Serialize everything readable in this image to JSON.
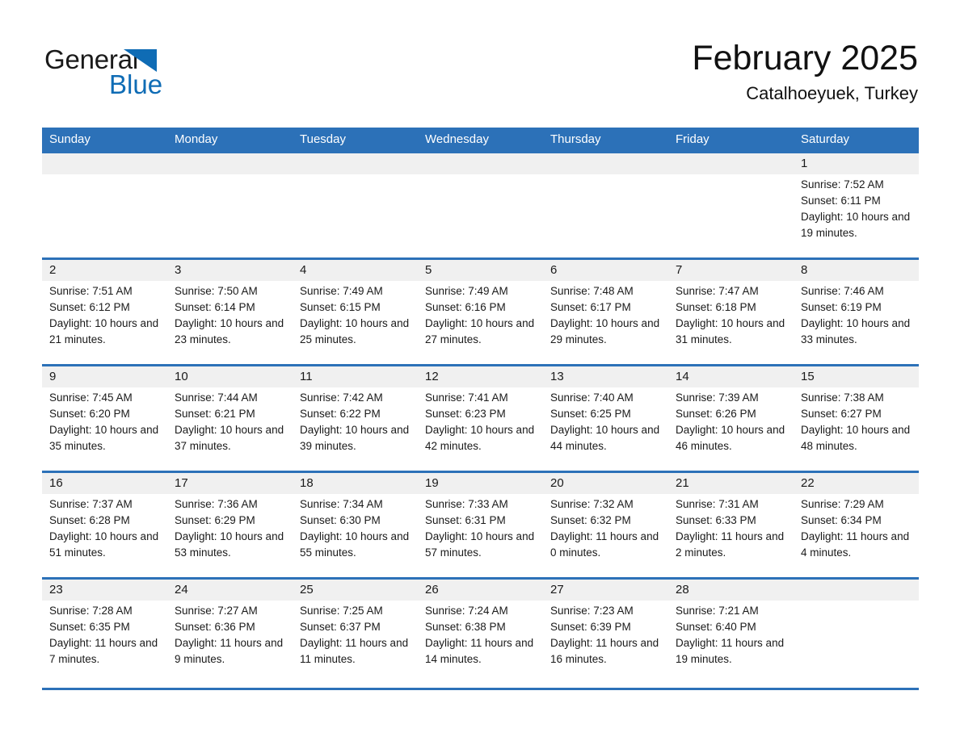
{
  "brand": {
    "name_part1": "General",
    "name_part2": "Blue",
    "logo_color": "#0f6cb5"
  },
  "header": {
    "title": "February 2025",
    "subtitle": "Catalhoeyuek, Turkey"
  },
  "theme": {
    "header_blue": "#2c71b8",
    "band_gray": "#f0f0f0",
    "text": "#1a1a1a"
  },
  "weekdays": [
    "Sunday",
    "Monday",
    "Tuesday",
    "Wednesday",
    "Thursday",
    "Friday",
    "Saturday"
  ],
  "weeks": [
    [
      {
        "day": "",
        "sunrise": "",
        "sunset": "",
        "daylight": ""
      },
      {
        "day": "",
        "sunrise": "",
        "sunset": "",
        "daylight": ""
      },
      {
        "day": "",
        "sunrise": "",
        "sunset": "",
        "daylight": ""
      },
      {
        "day": "",
        "sunrise": "",
        "sunset": "",
        "daylight": ""
      },
      {
        "day": "",
        "sunrise": "",
        "sunset": "",
        "daylight": ""
      },
      {
        "day": "",
        "sunrise": "",
        "sunset": "",
        "daylight": ""
      },
      {
        "day": "1",
        "sunrise": "Sunrise: 7:52 AM",
        "sunset": "Sunset: 6:11 PM",
        "daylight": "Daylight: 10 hours and 19 minutes."
      }
    ],
    [
      {
        "day": "2",
        "sunrise": "Sunrise: 7:51 AM",
        "sunset": "Sunset: 6:12 PM",
        "daylight": "Daylight: 10 hours and 21 minutes."
      },
      {
        "day": "3",
        "sunrise": "Sunrise: 7:50 AM",
        "sunset": "Sunset: 6:14 PM",
        "daylight": "Daylight: 10 hours and 23 minutes."
      },
      {
        "day": "4",
        "sunrise": "Sunrise: 7:49 AM",
        "sunset": "Sunset: 6:15 PM",
        "daylight": "Daylight: 10 hours and 25 minutes."
      },
      {
        "day": "5",
        "sunrise": "Sunrise: 7:49 AM",
        "sunset": "Sunset: 6:16 PM",
        "daylight": "Daylight: 10 hours and 27 minutes."
      },
      {
        "day": "6",
        "sunrise": "Sunrise: 7:48 AM",
        "sunset": "Sunset: 6:17 PM",
        "daylight": "Daylight: 10 hours and 29 minutes."
      },
      {
        "day": "7",
        "sunrise": "Sunrise: 7:47 AM",
        "sunset": "Sunset: 6:18 PM",
        "daylight": "Daylight: 10 hours and 31 minutes."
      },
      {
        "day": "8",
        "sunrise": "Sunrise: 7:46 AM",
        "sunset": "Sunset: 6:19 PM",
        "daylight": "Daylight: 10 hours and 33 minutes."
      }
    ],
    [
      {
        "day": "9",
        "sunrise": "Sunrise: 7:45 AM",
        "sunset": "Sunset: 6:20 PM",
        "daylight": "Daylight: 10 hours and 35 minutes."
      },
      {
        "day": "10",
        "sunrise": "Sunrise: 7:44 AM",
        "sunset": "Sunset: 6:21 PM",
        "daylight": "Daylight: 10 hours and 37 minutes."
      },
      {
        "day": "11",
        "sunrise": "Sunrise: 7:42 AM",
        "sunset": "Sunset: 6:22 PM",
        "daylight": "Daylight: 10 hours and 39 minutes."
      },
      {
        "day": "12",
        "sunrise": "Sunrise: 7:41 AM",
        "sunset": "Sunset: 6:23 PM",
        "daylight": "Daylight: 10 hours and 42 minutes."
      },
      {
        "day": "13",
        "sunrise": "Sunrise: 7:40 AM",
        "sunset": "Sunset: 6:25 PM",
        "daylight": "Daylight: 10 hours and 44 minutes."
      },
      {
        "day": "14",
        "sunrise": "Sunrise: 7:39 AM",
        "sunset": "Sunset: 6:26 PM",
        "daylight": "Daylight: 10 hours and 46 minutes."
      },
      {
        "day": "15",
        "sunrise": "Sunrise: 7:38 AM",
        "sunset": "Sunset: 6:27 PM",
        "daylight": "Daylight: 10 hours and 48 minutes."
      }
    ],
    [
      {
        "day": "16",
        "sunrise": "Sunrise: 7:37 AM",
        "sunset": "Sunset: 6:28 PM",
        "daylight": "Daylight: 10 hours and 51 minutes."
      },
      {
        "day": "17",
        "sunrise": "Sunrise: 7:36 AM",
        "sunset": "Sunset: 6:29 PM",
        "daylight": "Daylight: 10 hours and 53 minutes."
      },
      {
        "day": "18",
        "sunrise": "Sunrise: 7:34 AM",
        "sunset": "Sunset: 6:30 PM",
        "daylight": "Daylight: 10 hours and 55 minutes."
      },
      {
        "day": "19",
        "sunrise": "Sunrise: 7:33 AM",
        "sunset": "Sunset: 6:31 PM",
        "daylight": "Daylight: 10 hours and 57 minutes."
      },
      {
        "day": "20",
        "sunrise": "Sunrise: 7:32 AM",
        "sunset": "Sunset: 6:32 PM",
        "daylight": "Daylight: 11 hours and 0 minutes."
      },
      {
        "day": "21",
        "sunrise": "Sunrise: 7:31 AM",
        "sunset": "Sunset: 6:33 PM",
        "daylight": "Daylight: 11 hours and 2 minutes."
      },
      {
        "day": "22",
        "sunrise": "Sunrise: 7:29 AM",
        "sunset": "Sunset: 6:34 PM",
        "daylight": "Daylight: 11 hours and 4 minutes."
      }
    ],
    [
      {
        "day": "23",
        "sunrise": "Sunrise: 7:28 AM",
        "sunset": "Sunset: 6:35 PM",
        "daylight": "Daylight: 11 hours and 7 minutes."
      },
      {
        "day": "24",
        "sunrise": "Sunrise: 7:27 AM",
        "sunset": "Sunset: 6:36 PM",
        "daylight": "Daylight: 11 hours and 9 minutes."
      },
      {
        "day": "25",
        "sunrise": "Sunrise: 7:25 AM",
        "sunset": "Sunset: 6:37 PM",
        "daylight": "Daylight: 11 hours and 11 minutes."
      },
      {
        "day": "26",
        "sunrise": "Sunrise: 7:24 AM",
        "sunset": "Sunset: 6:38 PM",
        "daylight": "Daylight: 11 hours and 14 minutes."
      },
      {
        "day": "27",
        "sunrise": "Sunrise: 7:23 AM",
        "sunset": "Sunset: 6:39 PM",
        "daylight": "Daylight: 11 hours and 16 minutes."
      },
      {
        "day": "28",
        "sunrise": "Sunrise: 7:21 AM",
        "sunset": "Sunset: 6:40 PM",
        "daylight": "Daylight: 11 hours and 19 minutes."
      },
      {
        "day": "",
        "sunrise": "",
        "sunset": "",
        "daylight": ""
      }
    ]
  ]
}
